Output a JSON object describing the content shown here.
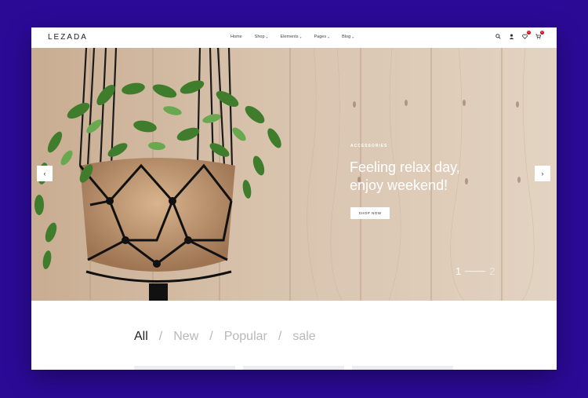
{
  "header": {
    "logo": "LEZADA",
    "nav": [
      {
        "label": "Home",
        "has_dropdown": false
      },
      {
        "label": "Shop",
        "has_dropdown": true
      },
      {
        "label": "Elements",
        "has_dropdown": true
      },
      {
        "label": "Pages",
        "has_dropdown": true
      },
      {
        "label": "Blog",
        "has_dropdown": true
      }
    ],
    "tools": [
      {
        "icon": "search-icon"
      },
      {
        "icon": "user-icon"
      },
      {
        "icon": "wishlist-icon",
        "badge": "0"
      },
      {
        "icon": "cart-icon",
        "badge": "0"
      }
    ]
  },
  "hero": {
    "eyebrow": "ACCESSORIES",
    "headline_line1": "Feeling relax day,",
    "headline_line2": "enjoy weekend!",
    "cta": "SHOP NOW",
    "prev_icon": "chevron-left-icon",
    "next_icon": "chevron-right-icon",
    "pager": {
      "current": "1",
      "next": "2"
    }
  },
  "filters": [
    {
      "label": "All",
      "active": true
    },
    {
      "label": "New",
      "active": false
    },
    {
      "label": "Popular",
      "active": false
    },
    {
      "label": "sale",
      "active": false
    }
  ],
  "colors": {
    "background": "#2b0a96",
    "badge": "#d0021b",
    "wood": "#d7c3ae"
  }
}
